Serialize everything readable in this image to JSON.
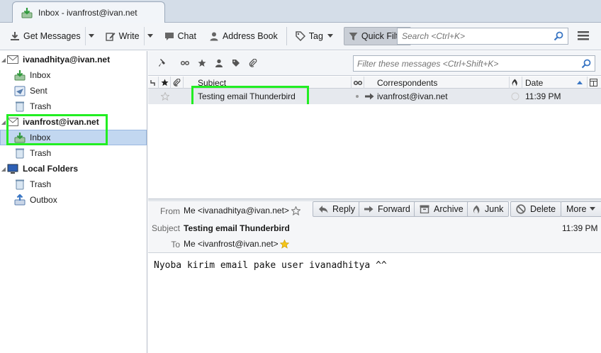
{
  "tab": {
    "title": "Inbox - ivanfrost@ivan.net"
  },
  "toolbar": {
    "get_messages": "Get Messages",
    "write": "Write",
    "chat": "Chat",
    "address_book": "Address Book",
    "tag": "Tag",
    "quick_filter": "Quick Filter",
    "search_placeholder": "Search <Ctrl+K>"
  },
  "folders": {
    "account1": "ivanadhitya@ivan.net",
    "account1_inbox": "Inbox",
    "account1_sent": "Sent",
    "account1_trash": "Trash",
    "account2": "ivanfrost@ivan.net",
    "account2_inbox": "Inbox",
    "account2_trash": "Trash",
    "local": "Local Folders",
    "local_trash": "Trash",
    "local_outbox": "Outbox"
  },
  "quickfilter": {
    "placeholder": "Filter these messages <Ctrl+Shift+K>"
  },
  "thread": {
    "columns": {
      "subject": "Subject",
      "correspondents": "Correspondents",
      "date": "Date"
    },
    "rows": [
      {
        "subject": "Testing email Thunderbird",
        "correspondent": "ivanfrost@ivan.net",
        "date": "11:39 PM"
      }
    ]
  },
  "message": {
    "labels": {
      "from": "From",
      "subject": "Subject",
      "to": "To"
    },
    "from": "Me <ivanadhitya@ivan.net>",
    "subject": "Testing email Thunderbird",
    "to": "Me <ivanfrost@ivan.net>",
    "date": "11:39 PM",
    "buttons": {
      "reply": "Reply",
      "forward": "Forward",
      "archive": "Archive",
      "junk": "Junk",
      "delete": "Delete",
      "more": "More"
    },
    "body": "Nyoba kirim email pake user ivanadhitya ^^"
  },
  "colors": {
    "highlight": "#22ee22",
    "selected": "#c2d7f0",
    "accent": "#3a76c4"
  }
}
